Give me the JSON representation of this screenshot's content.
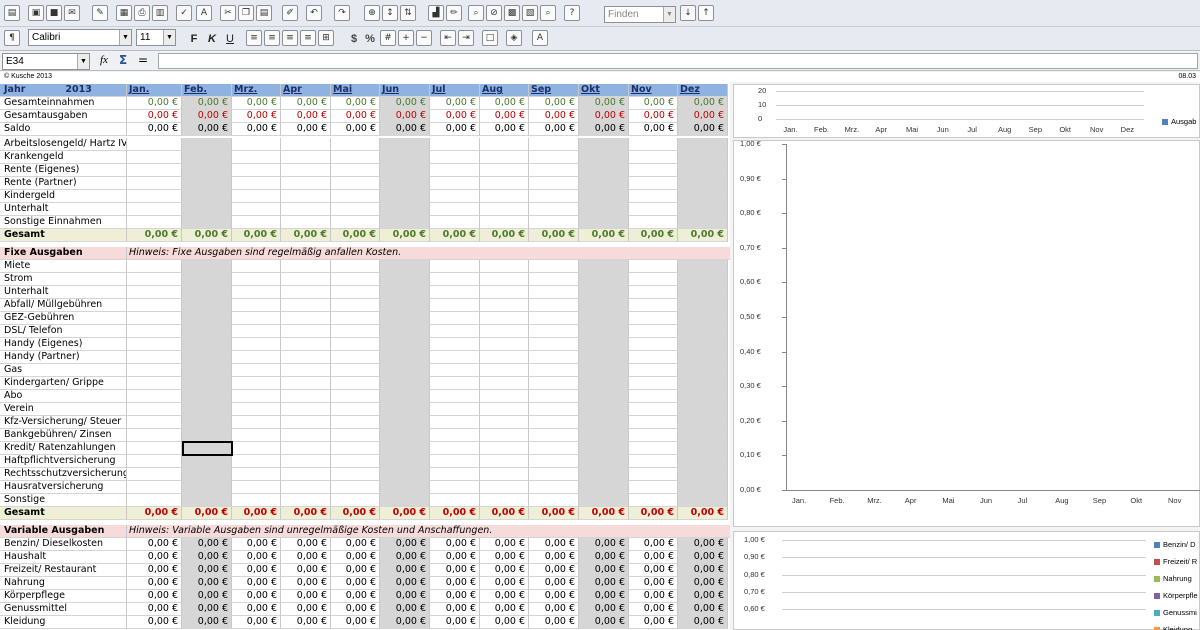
{
  "toolbar": {
    "find_placeholder": "Finden",
    "font_name": "Calibri",
    "font_size": "11",
    "bold": "F",
    "italic": "K",
    "underline": "U",
    "percent": "%",
    "currency": "$"
  },
  "formula_bar": {
    "name_box": "E34",
    "fx": "fx",
    "sum": "Σ",
    "equals": "=",
    "value": ""
  },
  "note": {
    "copyright": "© Kusche 2013",
    "date": "08.03"
  },
  "sheet": {
    "year_label": "Jahr",
    "year": "2013",
    "months": [
      "Jan.",
      "Feb.",
      "Mrz.",
      "Apr",
      "Mai",
      "Jun",
      "Jul",
      "Aug",
      "Sep",
      "Okt",
      "Nov",
      "Dez"
    ],
    "zero": "0,00 €",
    "summary": [
      "Gesamteinnahmen",
      "Gesamtausgaben",
      "Saldo"
    ],
    "income": [
      "Arbeitslosengeld/ Hartz IV",
      "Krankengeld",
      "Rente (Eigenes)",
      "Rente (Partner)",
      "Kindergeld",
      "Unterhalt",
      "Sonstige Einnahmen"
    ],
    "gesamt": "Gesamt",
    "fixed_title": "Fixe Ausgaben",
    "fixed_hint": "Hinweis: Fixe Ausgaben sind regelmäßig anfallen Kosten.",
    "fixed": [
      "Miete",
      "Strom",
      "Unterhalt",
      "Abfall/ Müllgebühren",
      "GEZ-Gebühren",
      "DSL/ Telefon",
      "Handy (Eigenes)",
      "Handy (Partner)",
      "Gas",
      "Kindergarten/ Grippe",
      "Abo",
      "Verein",
      "Kfz-Versicherung/ Steuer",
      "Bankgebühren/ Zinsen",
      "Kredit/ Ratenzahlungen",
      "Haftpflichtversicherung",
      "Rechtsschutzversicherung",
      "Hausratversicherung",
      "Sonstige"
    ],
    "var_title": "Variable Ausgaben",
    "var_hint": "Hinweis: Variable Ausgaben sind unregelmäßige Kosten und Anschaffungen.",
    "variable": [
      "Benzin/ Dieselkosten",
      "Haushalt",
      "Freizeit/ Restaurant",
      "Nahrung",
      "Körperpflege",
      "Genussmittel",
      "Kleidung"
    ]
  },
  "charts": {
    "top": {
      "y_ticks": [
        "20",
        "10",
        "0"
      ],
      "x_ticks": [
        "Jan.",
        "Feb.",
        "Mrz.",
        "Apr",
        "Mai",
        "Jun",
        "Jul",
        "Aug",
        "Sep",
        "Okt",
        "Nov",
        "Dez"
      ],
      "legend": "Ausgab"
    },
    "mid": {
      "y_ticks": [
        "1,00 €",
        "0,90 €",
        "0,80 €",
        "0,70 €",
        "0,60 €",
        "0,50 €",
        "0,40 €",
        "0,30 €",
        "0,20 €",
        "0,10 €",
        "0,00 €"
      ],
      "x_ticks": [
        "Jan.",
        "Feb.",
        "Mrz.",
        "Apr",
        "Mai",
        "Jun",
        "Jul",
        "Aug",
        "Sep",
        "Okt",
        "Nov"
      ]
    },
    "bottom": {
      "y_ticks": [
        "1,00 €",
        "0,90 €",
        "0,80 €",
        "0,70 €",
        "0,60 €"
      ],
      "legend": [
        "Benzin/ D",
        "Freizeit/ R",
        "Nahrung",
        "Körperpfle",
        "Genussmi",
        "Kleidung"
      ],
      "legend_colors": [
        "#4f81bd",
        "#c0504d",
        "#9bbb59",
        "#8064a2",
        "#4bacc6",
        "#f79646"
      ]
    }
  },
  "colors": {
    "month_header": "#8fb3e0",
    "grey_column": "#d6d6d6",
    "hint_pink": "#f7dbdb",
    "income_green": "#4b7a2b",
    "expense_red": "#c00000"
  }
}
